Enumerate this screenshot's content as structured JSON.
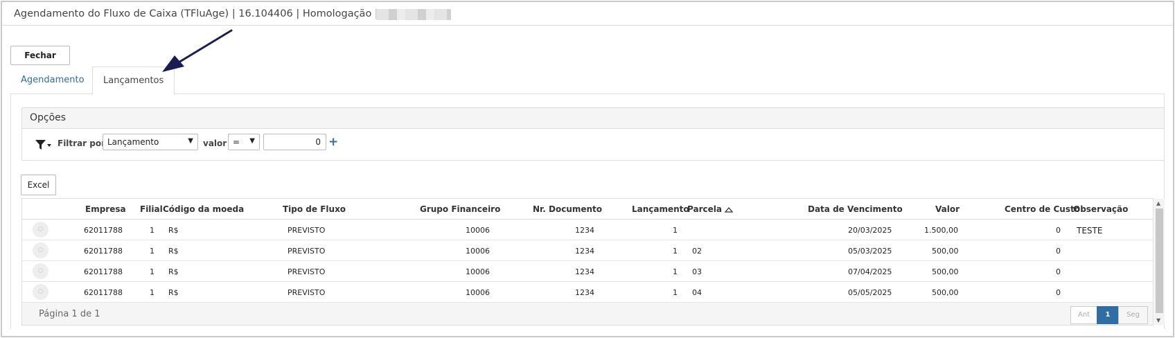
{
  "window": {
    "title": "Agendamento do Fluxo de Caixa (TFluAge) | 16.104406 | Homologação |"
  },
  "toolbar": {
    "close_label": "Fechar"
  },
  "tabs": [
    {
      "label": "Agendamento"
    },
    {
      "label": "Lançamentos"
    }
  ],
  "options": {
    "title": "Opções",
    "filter_by_label": "Filtrar por",
    "filter_field": "Lançamento",
    "value_label": "valor",
    "operator": "=",
    "value": "0"
  },
  "export": {
    "excel_label": "Excel"
  },
  "grid": {
    "columns": [
      "Empresa",
      "Filial",
      "Código da moeda",
      "Tipo de Fluxo",
      "Grupo Financeiro",
      "Nr. Documento",
      "Lançamento",
      "Parcela",
      "Data de Vencimento",
      "Valor",
      "Centro de Custo",
      "Observação"
    ],
    "rows": [
      {
        "empresa": "62011788",
        "filial": "1",
        "moeda": "R$",
        "tipo": "PREVISTO",
        "grupo": "10006",
        "documento": "1234",
        "lancamento": "1",
        "parcela": "",
        "vencimento": "20/03/2025",
        "valor": "1.500,00",
        "centro": "0",
        "obs": "TESTE"
      },
      {
        "empresa": "62011788",
        "filial": "1",
        "moeda": "R$",
        "tipo": "PREVISTO",
        "grupo": "10006",
        "documento": "1234",
        "lancamento": "1",
        "parcela": "02",
        "vencimento": "05/03/2025",
        "valor": "500,00",
        "centro": "0",
        "obs": ""
      },
      {
        "empresa": "62011788",
        "filial": "1",
        "moeda": "R$",
        "tipo": "PREVISTO",
        "grupo": "10006",
        "documento": "1234",
        "lancamento": "1",
        "parcela": "03",
        "vencimento": "07/04/2025",
        "valor": "500,00",
        "centro": "0",
        "obs": ""
      },
      {
        "empresa": "62011788",
        "filial": "1",
        "moeda": "R$",
        "tipo": "PREVISTO",
        "grupo": "10006",
        "documento": "1234",
        "lancamento": "1",
        "parcela": "04",
        "vencimento": "05/05/2025",
        "valor": "500,00",
        "centro": "0",
        "obs": ""
      }
    ],
    "sorted_column": "Parcela",
    "page_info": "Página 1 de 1",
    "pager": {
      "prev": "Ant",
      "current": "1",
      "next": "Seg"
    }
  },
  "colors": {
    "accent": "#2f6ea4",
    "border": "#dcdcdc",
    "arrow": "#1c1c55"
  },
  "icons": [
    "filter-icon",
    "plus-icon",
    "magnifier-icon",
    "sort-asc-icon",
    "arrow-annotation-icon"
  ]
}
